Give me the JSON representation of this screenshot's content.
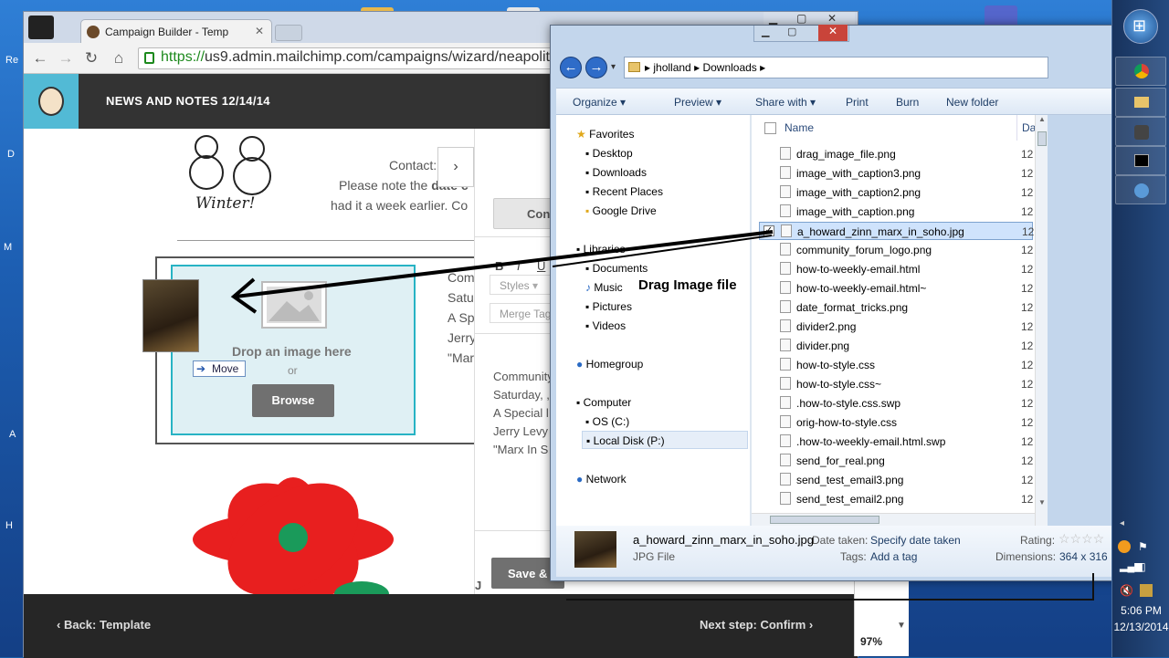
{
  "browser": {
    "tab_title": "Campaign Builder - Temp",
    "url_https": "https://",
    "url_rest": "us9.admin.mailchimp.com/campaigns/wizard/neapolit"
  },
  "mailchimp": {
    "campaign_title": "NEWS AND NOTES 12/14/14",
    "contact_label": "Contact:",
    "body_line1_prefix": "Please note the",
    "body_line1_bold": "date c",
    "body_line2": "had it a week earlier.  Co",
    "winter_caption": "Winter!",
    "drop_label": "Drop an image here",
    "or_label": "or",
    "browse_label": "Browse",
    "move_label": "Move",
    "drag_annotation": "Drag Image file",
    "preview_lines": [
      "Com",
      "Satu",
      "A Sp",
      "Jerry",
      "\"Mar"
    ],
    "editor": {
      "con_button": "Con",
      "bold": "B",
      "italic": "I",
      "underline": "U",
      "styles": "Styles",
      "merge_tags": "Merge Tag",
      "content_lines": [
        "Community",
        "Saturday, ,",
        "A Special l",
        "Jerry Levy",
        "\"Marx In S"
      ],
      "save_button": "Save &"
    },
    "footer_back": "Back: Template",
    "footer_next": "Next step: Confirm",
    "zoom": "97%",
    "footer_j": "J"
  },
  "explorer": {
    "breadcrumb": [
      "jholland",
      "Downloads"
    ],
    "commands": [
      "Organize",
      "Preview",
      "Share with",
      "Print",
      "Burn",
      "New folder"
    ],
    "nav": {
      "favorites_header": "Favorites",
      "favorites": [
        "Desktop",
        "Downloads",
        "Recent Places",
        "Google Drive"
      ],
      "libraries_header": "Libraries",
      "libraries": [
        "Documents",
        "Music",
        "Pictures",
        "Videos"
      ],
      "homegroup": "Homegroup",
      "computer_header": "Computer",
      "drives": [
        "OS (C:)",
        "Local Disk (P:)"
      ],
      "network": "Network"
    },
    "columns": {
      "name": "Name",
      "date": "Da"
    },
    "files": [
      {
        "name": "drag_image_file.png",
        "date": "12"
      },
      {
        "name": "image_with_caption3.png",
        "date": "12"
      },
      {
        "name": "image_with_caption2.png",
        "date": "12"
      },
      {
        "name": "image_with_caption.png",
        "date": "12"
      },
      {
        "name": "a_howard_zinn_marx_in_soho.jpg",
        "date": "12",
        "selected": true
      },
      {
        "name": "community_forum_logo.png",
        "date": "12"
      },
      {
        "name": "how-to-weekly-email.html",
        "date": "12"
      },
      {
        "name": "how-to-weekly-email.html~",
        "date": "12"
      },
      {
        "name": "date_format_tricks.png",
        "date": "12"
      },
      {
        "name": "divider2.png",
        "date": "12"
      },
      {
        "name": "divider.png",
        "date": "12"
      },
      {
        "name": "how-to-style.css",
        "date": "12"
      },
      {
        "name": "how-to-style.css~",
        "date": "12"
      },
      {
        "name": ".how-to-style.css.swp",
        "date": "12"
      },
      {
        "name": "orig-how-to-style.css",
        "date": "12"
      },
      {
        "name": ".how-to-weekly-email.html.swp",
        "date": "12"
      },
      {
        "name": "send_for_real.png",
        "date": "12"
      },
      {
        "name": "send_test_email3.png",
        "date": "12"
      },
      {
        "name": "send_test_email2.png",
        "date": "12"
      }
    ],
    "details": {
      "filename": "a_howard_zinn_marx_in_soho.jpg",
      "type": "JPG File",
      "date_taken_label": "Date taken:",
      "date_taken_value": "Specify date taken",
      "tags_label": "Tags:",
      "tags_value": "Add a tag",
      "rating_label": "Rating:",
      "dimensions_label": "Dimensions:",
      "dimensions_value": "364 x 316"
    }
  },
  "taskbar": {
    "time": "5:06 PM",
    "date": "12/13/2014"
  },
  "desktop_chars": [
    "Re",
    "D",
    "M",
    "A",
    "H"
  ]
}
